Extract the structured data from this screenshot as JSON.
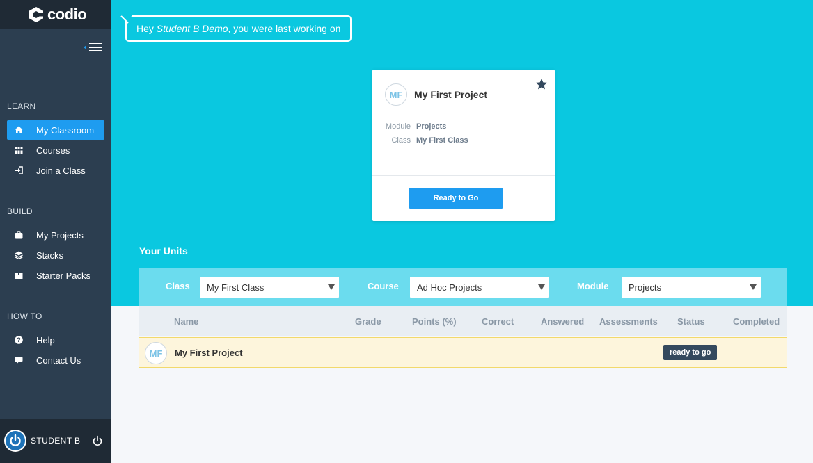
{
  "brand": {
    "name": "codio"
  },
  "sidebar": {
    "sections": [
      {
        "label": "LEARN"
      },
      {
        "label": "BUILD"
      },
      {
        "label": "HOW TO"
      }
    ],
    "items": [
      {
        "label": "My Classroom",
        "icon": "home-icon"
      },
      {
        "label": "Courses",
        "icon": "courses-icon"
      },
      {
        "label": "Join a Class",
        "icon": "sign-in-icon"
      },
      {
        "label": "My Projects",
        "icon": "briefcase-icon"
      },
      {
        "label": "Stacks",
        "icon": "layers-icon"
      },
      {
        "label": "Starter Packs",
        "icon": "package-icon"
      },
      {
        "label": "Help",
        "icon": "question-icon"
      },
      {
        "label": "Contact Us",
        "icon": "chat-icon"
      }
    ],
    "user": {
      "name": "STUDENT B"
    }
  },
  "greeting": {
    "prefix": "Hey ",
    "user": "Student B Demo",
    "suffix": ", you were last working on"
  },
  "card": {
    "initials": "MF",
    "title": "My First Project",
    "module_key": "Module",
    "module_val": "Projects",
    "class_key": "Class",
    "class_val": "My First Class",
    "button": "Ready to Go"
  },
  "units": {
    "title": "Your Units",
    "filters": {
      "class_label": "Class",
      "class_value": "My First Class",
      "course_label": "Course",
      "course_value": "Ad Hoc Projects",
      "module_label": "Module",
      "module_value": "Projects"
    },
    "columns": [
      "Name",
      "Grade",
      "Points (%)",
      "Correct",
      "Answered",
      "Assessments",
      "Status",
      "Completed"
    ],
    "rows": [
      {
        "initials": "MF",
        "name": "My First Project",
        "status": "ready to go"
      }
    ]
  },
  "colors": {
    "accent": "#1e9cf0",
    "hero": "#0ac8e0",
    "sidebar": "#2c3e50"
  }
}
